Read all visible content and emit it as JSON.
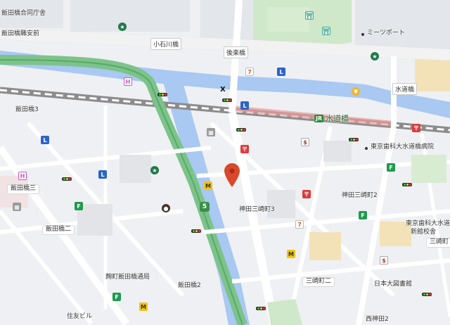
{
  "map": {
    "colors": {
      "background": "#eef0f3",
      "water": "#a9c8f2",
      "block": "#e2e4e8",
      "park": "#cfe8c9",
      "highway": "#7cc38a",
      "railway": "#8c8c8c",
      "major_road": "#ffffff",
      "pin": "#d9482b"
    },
    "labels": {
      "top_left_area": "飯田橋合同庁舎",
      "iidabashi_mae": "飯田橋職安前",
      "koishikawa_bridge": "小石川橋",
      "korakubashi": "後楽橋",
      "meets_port": "ミーツポート",
      "suidobashi_road": "水道橋",
      "suidobashi_station": "水道橋",
      "station_line_mark": "JR",
      "iidabashi3": "飯田橋3",
      "iidabashi_san": "飯田橋三",
      "iidabashi_ni": "飯田橋二",
      "iidabashi2": "飯田橋2",
      "kojimachi_post": "麹町飯田橋通局",
      "hospital": "東京歯科大水道橋病院",
      "hospital_new": "東京歯科大水道橋",
      "hospital_new2": "新館校舎",
      "kanda_misaki2": "神田三崎町2",
      "kanda_misaki3": "神田三崎町3",
      "misakicho2": "三崎町二",
      "misakicho_right": "三崎町",
      "nihon_univ": "日本大図書館",
      "nishi_kanda2": "西神田2",
      "route_number": "5",
      "bottom_left_text": "住友ビル"
    },
    "pois": [
      {
        "type": "starbucks",
        "name": "starbucks-icon"
      },
      {
        "type": "seven-eleven",
        "name": "seven-eleven-icon"
      },
      {
        "type": "lawson",
        "name": "lawson-icon"
      },
      {
        "type": "familymart",
        "name": "familymart-icon"
      },
      {
        "type": "ministop",
        "name": "ministop-icon"
      },
      {
        "type": "post-office",
        "name": "post-office-icon"
      },
      {
        "type": "bank",
        "name": "bank-icon"
      },
      {
        "type": "hospital",
        "name": "hospital-icon"
      },
      {
        "type": "cafe",
        "name": "cafe-icon"
      }
    ],
    "marker": {
      "name": "location-pin",
      "color": "#d9482b"
    }
  }
}
